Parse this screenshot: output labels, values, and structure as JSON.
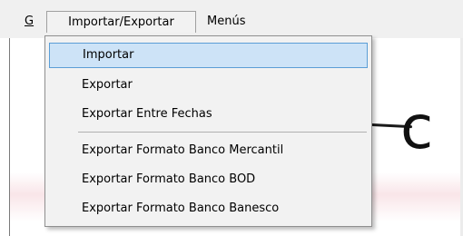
{
  "menubar": {
    "g_label": "G",
    "importar_exportar_label": "Importar/Exportar",
    "menus_label": "Menús"
  },
  "dropdown": {
    "items": [
      {
        "label": "Importar",
        "selected": true
      },
      {
        "label": "Exportar"
      },
      {
        "label": "Exportar Entre Fechas"
      },
      {
        "label": "Exportar Formato Banco Mercantil"
      },
      {
        "label": "Exportar Formato Banco BOD"
      },
      {
        "label": "Exportar Formato Banco Banesco"
      }
    ]
  },
  "background": {
    "large_glyph": "c"
  }
}
